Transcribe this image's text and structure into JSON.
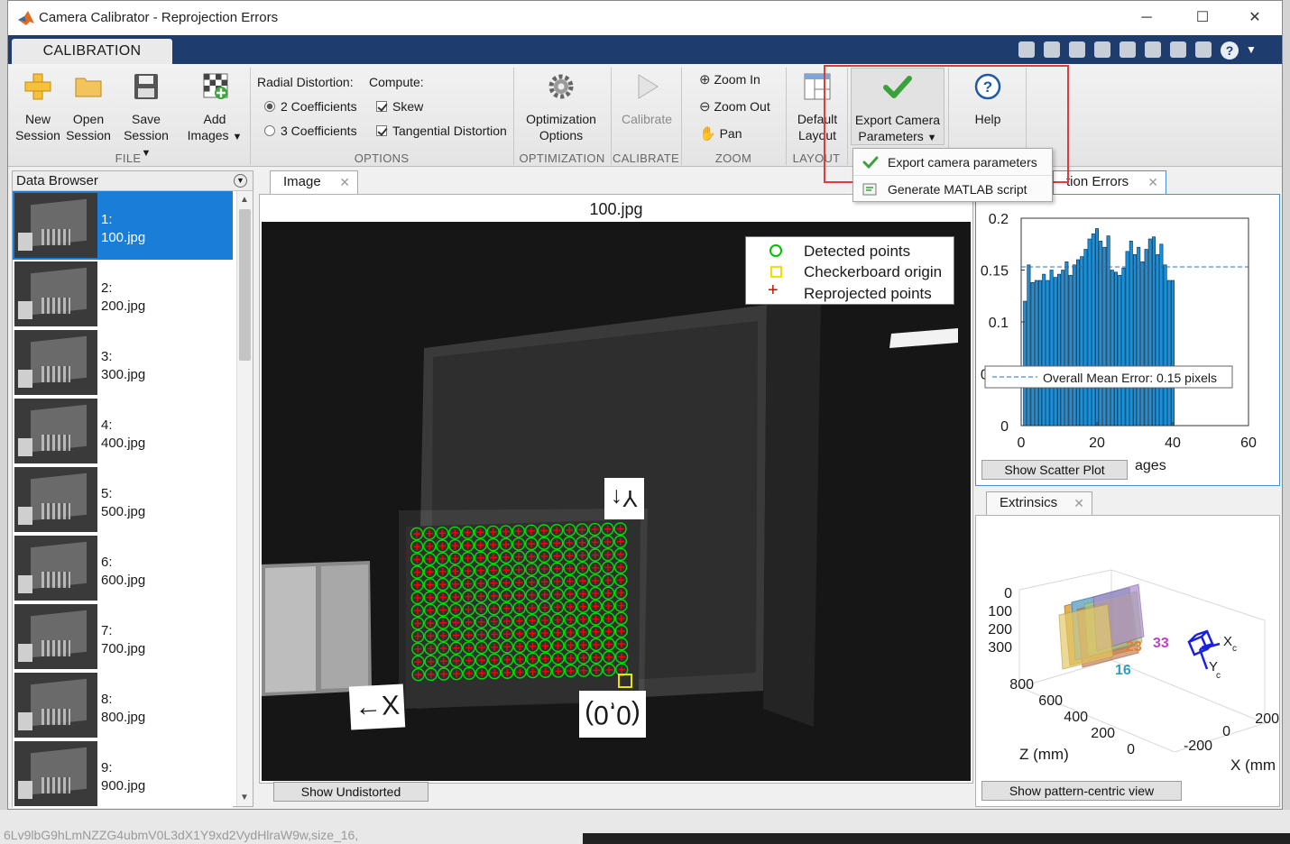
{
  "window": {
    "title": "Camera Calibrator - Reprojection Errors",
    "controls": [
      "─",
      "☐",
      "✕"
    ]
  },
  "toolstrip": {
    "tab_label": "CALIBRATION"
  },
  "ribbon": {
    "file": {
      "label": "FILE",
      "new_session": "New\nSession",
      "open_session": "Open\nSession",
      "save_session": "Save\nSession",
      "add_images": "Add\nImages"
    },
    "options": {
      "label": "OPTIONS",
      "radial_distortion": "Radial Distortion:",
      "compute": "Compute:",
      "coef2": "2 Coefficients",
      "coef3": "3 Coefficients",
      "skew": "Skew",
      "tangential": "Tangential Distortion"
    },
    "optimization": {
      "label": "OPTIMIZATION",
      "button": "Optimization\nOptions"
    },
    "calibrate": {
      "label": "CALIBRATE",
      "button": "Calibrate"
    },
    "zoom": {
      "label": "ZOOM",
      "zoom_in": "Zoom In",
      "zoom_out": "Zoom Out",
      "pan": "Pan"
    },
    "layout": {
      "label": "LAYOUT",
      "button": "Default\nLayout"
    },
    "export": {
      "button": "Export Camera\nParameters"
    },
    "help": {
      "button": "Help"
    }
  },
  "dropdown": {
    "items": [
      "Export camera parameters",
      "Generate MATLAB script"
    ]
  },
  "data_browser": {
    "title": "Data Browser",
    "items": [
      {
        "index": "1:",
        "name": "100.jpg"
      },
      {
        "index": "2:",
        "name": "200.jpg"
      },
      {
        "index": "3:",
        "name": "300.jpg"
      },
      {
        "index": "4:",
        "name": "400.jpg"
      },
      {
        "index": "5:",
        "name": "500.jpg"
      },
      {
        "index": "6:",
        "name": "600.jpg"
      },
      {
        "index": "7:",
        "name": "700.jpg"
      },
      {
        "index": "8:",
        "name": "800.jpg"
      },
      {
        "index": "9:",
        "name": "900.jpg"
      }
    ],
    "selected_index": 0
  },
  "image_panel": {
    "tab": "Image",
    "image_title": "100.jpg",
    "legend": [
      "Detected points",
      "Checkerboard origin",
      "Reprojected points"
    ],
    "axis_y_label": "Y↑",
    "axis_x_label": "←X",
    "origin_label": "(0,0)",
    "show_undistorted": "Show Undistorted",
    "colors": {
      "detected": "#00e000",
      "origin": "#f0e000",
      "reprojected": "#ff0000"
    }
  },
  "reprojection_panel": {
    "tab_suffix": "tion Errors",
    "show_scatter": "Show Scatter Plot",
    "xlabel_fragment": "ages",
    "legend": "Overall Mean Error: 0.15 pixels"
  },
  "chart_data": {
    "type": "bar",
    "title": "",
    "xlabel": "",
    "ylabel": "",
    "xlim": [
      0,
      60
    ],
    "ylim": [
      0,
      0.2
    ],
    "xticks": [
      "0",
      "20",
      "40",
      "60"
    ],
    "yticks": [
      "0",
      "0.05",
      "0.1",
      "0.15",
      "0.2"
    ],
    "categories": [
      1,
      2,
      3,
      4,
      5,
      6,
      7,
      8,
      9,
      10,
      11,
      12,
      13,
      14,
      15,
      16,
      17,
      18,
      19,
      20,
      21,
      22,
      23,
      24,
      25,
      26,
      27,
      28,
      29,
      30,
      31,
      32,
      33,
      34,
      35,
      36,
      37,
      38,
      39,
      40
    ],
    "values": [
      0.12,
      0.155,
      0.138,
      0.14,
      0.14,
      0.146,
      0.14,
      0.15,
      0.143,
      0.146,
      0.15,
      0.158,
      0.145,
      0.155,
      0.16,
      0.163,
      0.17,
      0.18,
      0.185,
      0.19,
      0.178,
      0.172,
      0.183,
      0.15,
      0.148,
      0.145,
      0.152,
      0.168,
      0.178,
      0.165,
      0.172,
      0.158,
      0.17,
      0.18,
      0.182,
      0.165,
      0.175,
      0.155,
      0.14,
      0.14
    ],
    "mean_line": 0.153,
    "bar_color": "#1a90d8"
  },
  "extrinsics_panel": {
    "tab": "Extrinsics",
    "show_pattern": "Show pattern-centric view",
    "z_ticks": [
      "0",
      "100",
      "200",
      "300"
    ],
    "y_ticks": [
      "800",
      "600",
      "400",
      "200",
      "0"
    ],
    "x_ticks": [
      "200",
      "0",
      "-200"
    ],
    "zlabel": "Z (mm)",
    "xlabel": "X (mm",
    "board_labels": [
      "23",
      "16",
      "33"
    ]
  },
  "status_text": "6Lv9lbG9hLmNZZG4ubmV0L3dX1Y9xd2VydHlraW9w,size_16,"
}
